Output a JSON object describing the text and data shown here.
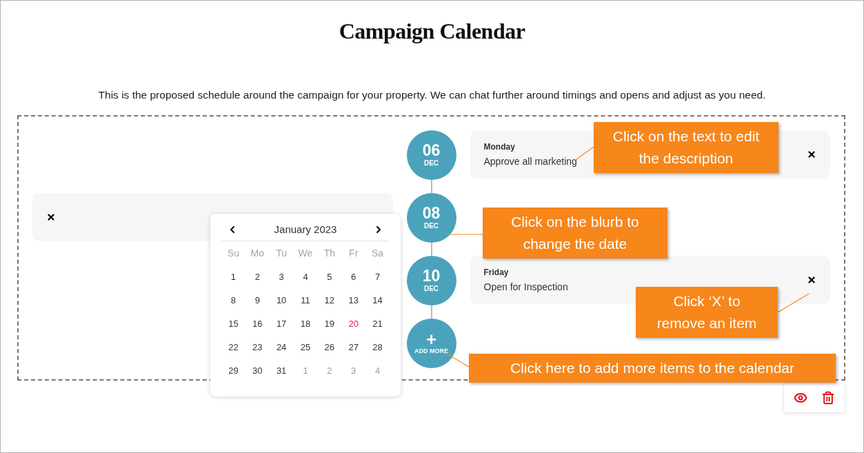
{
  "title": "Campaign Calendar",
  "intro": "This is the proposed schedule around the campaign for your property. We can chat further around timings and opens and adjust as you need.",
  "entries": [
    {
      "day": "06",
      "month": "DEC",
      "kind": "event",
      "weekday": "Monday",
      "description": "Approve all marketing"
    },
    {
      "day": "08",
      "month": "DEC",
      "kind": "empty"
    },
    {
      "day": "10",
      "month": "DEC",
      "kind": "event",
      "weekday": "Friday",
      "description": "Open for Inspection"
    }
  ],
  "add_more": {
    "plus": "+",
    "label": "ADD MORE"
  },
  "date_picker": {
    "month": "January 2023",
    "weekdays": [
      "Su",
      "Mo",
      "Tu",
      "We",
      "Th",
      "Fr",
      "Sa"
    ],
    "weeks": [
      [
        {
          "label": "1",
          "outside": false,
          "today": false
        },
        {
          "label": "2",
          "outside": false,
          "today": false
        },
        {
          "label": "3",
          "outside": false,
          "today": false
        },
        {
          "label": "4",
          "outside": false,
          "today": false
        },
        {
          "label": "5",
          "outside": false,
          "today": false
        },
        {
          "label": "6",
          "outside": false,
          "today": false
        },
        {
          "label": "7",
          "outside": false,
          "today": false
        }
      ],
      [
        {
          "label": "8",
          "outside": false,
          "today": false
        },
        {
          "label": "9",
          "outside": false,
          "today": false
        },
        {
          "label": "10",
          "outside": false,
          "today": false
        },
        {
          "label": "11",
          "outside": false,
          "today": false
        },
        {
          "label": "12",
          "outside": false,
          "today": false
        },
        {
          "label": "13",
          "outside": false,
          "today": false
        },
        {
          "label": "14",
          "outside": false,
          "today": false
        }
      ],
      [
        {
          "label": "15",
          "outside": false,
          "today": false
        },
        {
          "label": "16",
          "outside": false,
          "today": false
        },
        {
          "label": "17",
          "outside": false,
          "today": false
        },
        {
          "label": "18",
          "outside": false,
          "today": false
        },
        {
          "label": "19",
          "outside": false,
          "today": false
        },
        {
          "label": "20",
          "outside": false,
          "today": true
        },
        {
          "label": "21",
          "outside": false,
          "today": false
        }
      ],
      [
        {
          "label": "22",
          "outside": false,
          "today": false
        },
        {
          "label": "23",
          "outside": false,
          "today": false
        },
        {
          "label": "24",
          "outside": false,
          "today": false
        },
        {
          "label": "25",
          "outside": false,
          "today": false
        },
        {
          "label": "26",
          "outside": false,
          "today": false
        },
        {
          "label": "27",
          "outside": false,
          "today": false
        },
        {
          "label": "28",
          "outside": false,
          "today": false
        }
      ],
      [
        {
          "label": "29",
          "outside": false,
          "today": false
        },
        {
          "label": "30",
          "outside": false,
          "today": false
        },
        {
          "label": "31",
          "outside": false,
          "today": false
        },
        {
          "label": "1",
          "outside": true,
          "today": false
        },
        {
          "label": "2",
          "outside": true,
          "today": false
        },
        {
          "label": "3",
          "outside": true,
          "today": false
        },
        {
          "label": "4",
          "outside": true,
          "today": false
        }
      ]
    ]
  },
  "annotations": [
    "Click on the text to edit the description",
    "Click on the blurb to change the date",
    "Click ‘X’ to remove an item",
    "Click here to add more items to the calendar"
  ]
}
